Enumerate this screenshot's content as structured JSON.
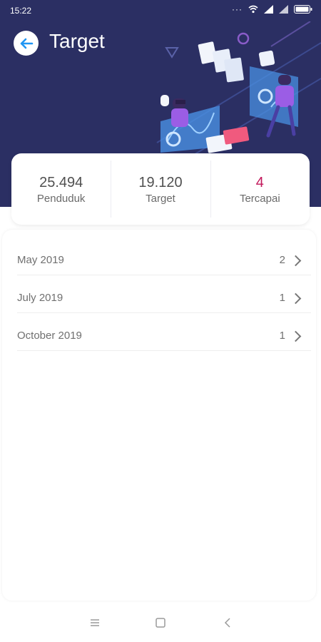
{
  "status_bar": {
    "time": "15:22",
    "dots": "···"
  },
  "header": {
    "title": "Target"
  },
  "stats": [
    {
      "value": "25.494",
      "label": "Penduduk"
    },
    {
      "value": "19.120",
      "label": "Target"
    },
    {
      "value": "4",
      "label": "Tercapai"
    }
  ],
  "months": [
    {
      "label": "May 2019",
      "count": "2"
    },
    {
      "label": "July 2019",
      "count": "1"
    },
    {
      "label": "October 2019",
      "count": "1"
    }
  ],
  "colors": {
    "header_bg": "#2b2f63",
    "accent": "#c2185b",
    "back_arrow": "#2196f3"
  },
  "icons": [
    "arrow-left-icon",
    "wifi-icon",
    "signal-icon",
    "battery-icon",
    "chevron-right-icon",
    "menu-icon",
    "home-icon",
    "back-icon"
  ]
}
